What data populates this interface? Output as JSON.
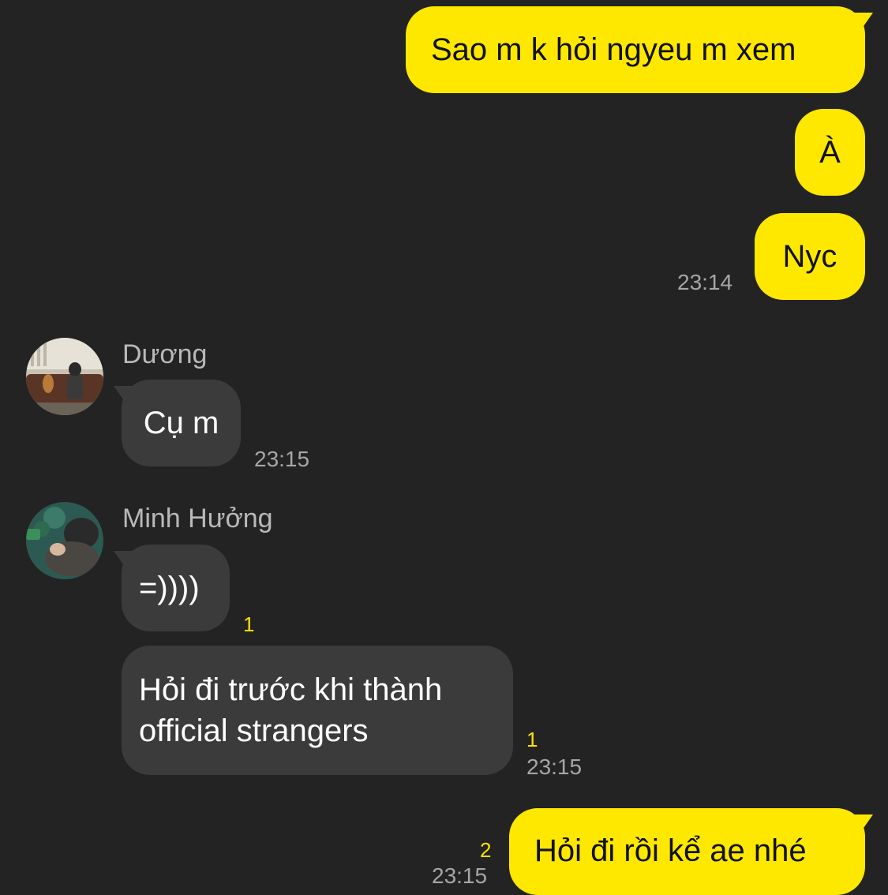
{
  "messages": {
    "m1": {
      "text": "Sao m k hỏi ngyeu m xem"
    },
    "m2": {
      "text": "À"
    },
    "m3": {
      "text": "Nyc",
      "time": "23:14"
    },
    "m4": {
      "sender": "Dương",
      "text": "Cụ m",
      "time": "23:15"
    },
    "m5": {
      "sender": "Minh Hưởng",
      "text": "=))))",
      "unread": "1"
    },
    "m6": {
      "text_line1": "Hỏi đi trước khi thành",
      "text_line2": "official strangers",
      "unread": "1",
      "time": "23:15"
    },
    "m7": {
      "text": "Hỏi đi rồi kể ae nhé",
      "unread": "2",
      "time": "23:15"
    }
  },
  "colors": {
    "background": "#232323",
    "outgoing_bubble": "#ffe800",
    "incoming_bubble": "#3b3b3b",
    "unread_count": "#ffe100"
  }
}
